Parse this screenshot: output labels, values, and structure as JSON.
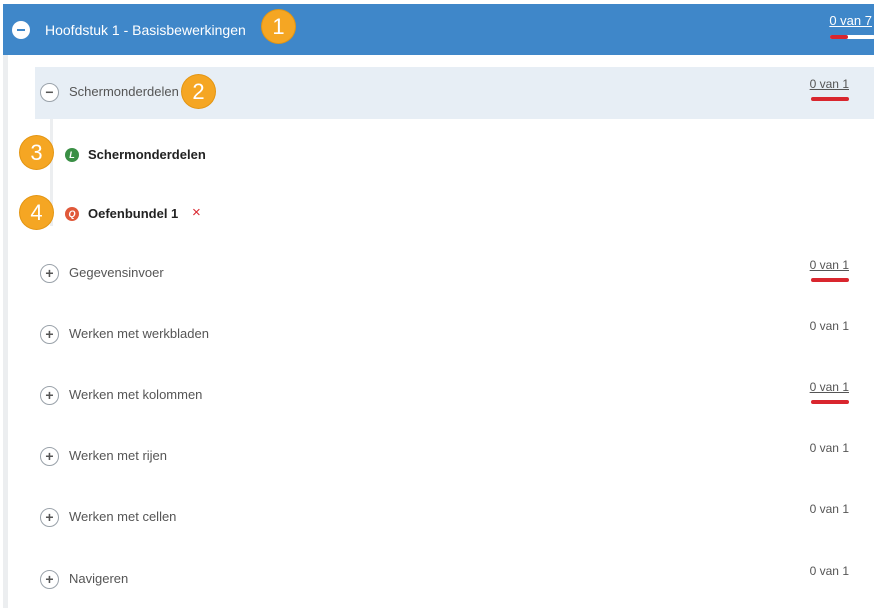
{
  "chapter": {
    "toggle_icon": "collapse-icon",
    "title": "Hoofdstuk 1 - Basisbewerkingen",
    "progress": "0 van 7",
    "progress_fraction": 0.4
  },
  "active_section": {
    "toggle_icon": "collapse-icon",
    "label": "Schermonderdelen",
    "progress": "0 van 1"
  },
  "lessons": [
    {
      "type_icon": "learn-icon",
      "type_letter": "L",
      "label": "Schermonderdelen"
    },
    {
      "type_icon": "quiz-icon",
      "type_letter": "Q",
      "label": "Oefenbundel 1",
      "remove_icon": "close-icon",
      "remove_glyph": "×"
    }
  ],
  "sections": [
    {
      "label": "Gegevensinvoer",
      "progress": "0 van 1"
    },
    {
      "label": "Werken met werkbladen",
      "progress": "0 van 1"
    },
    {
      "label": "Werken met kolommen",
      "progress": "0 van 1"
    },
    {
      "label": "Werken met rijen",
      "progress": "0 van 1"
    },
    {
      "label": "Werken met cellen",
      "progress": "0 van 1"
    },
    {
      "label": "Navigeren",
      "progress": "0 van 1"
    }
  ],
  "callouts": [
    "1",
    "2",
    "3",
    "4"
  ],
  "colors": {
    "header_blue": "#3f87c9",
    "accent_red": "#d9262e",
    "callout_orange": "#f5a623",
    "learn_green": "#3a8f45",
    "quiz_orange": "#e0593a"
  }
}
